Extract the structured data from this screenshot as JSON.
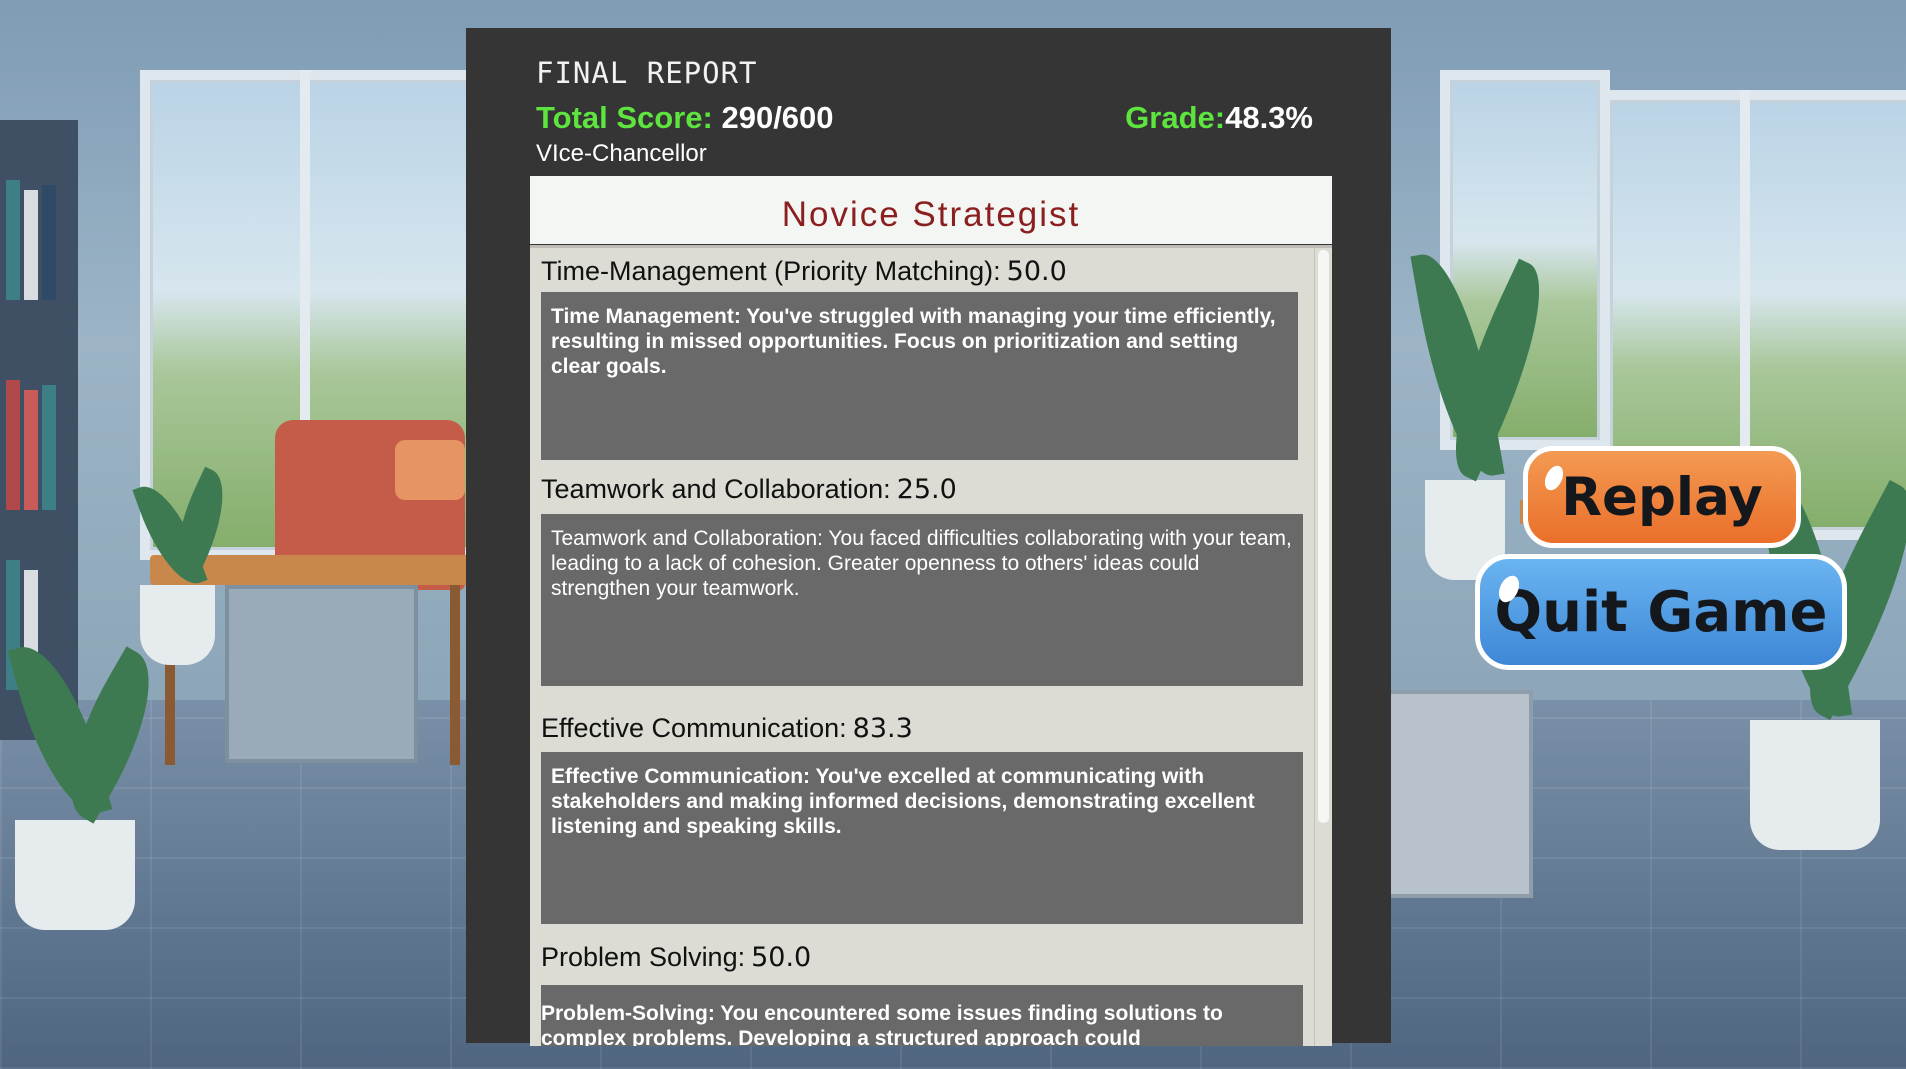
{
  "report": {
    "title": "FINAL REPORT",
    "total_score_label": "Total Score:",
    "total_score_value": "290/600",
    "grade_label": "Grade:",
    "grade_value": "48.3%",
    "role": "VIce-Chancellor",
    "rank_title": "Novice Strategist",
    "sections": [
      {
        "name": "Time-Management (Priority Matching):",
        "score": "50.0",
        "feedback": "Time Management: You've struggled with managing your time efficiently, resulting in missed opportunities. Focus on prioritization and setting clear goals."
      },
      {
        "name": "Teamwork and Collaboration:",
        "score": "25.0",
        "feedback": "Teamwork and Collaboration: You faced difficulties collaborating with your team, leading to a lack of cohesion. Greater openness to others' ideas could strengthen your teamwork."
      },
      {
        "name": "Effective Communication:",
        "score": "83.3",
        "feedback": "Effective Communication: You've excelled at communicating with stakeholders and making informed decisions, demonstrating excellent listening and speaking skills."
      },
      {
        "name": "Problem Solving:",
        "score": "50.0",
        "feedback": "Problem-Solving: You encountered some issues finding solutions to complex problems. Developing a structured approach could"
      }
    ]
  },
  "buttons": {
    "replay": "Replay",
    "quit": "Quit Game"
  },
  "colors": {
    "panel": "#353535",
    "accent_green": "#5ee43e",
    "rank_red": "#8b1e1e",
    "replay_orange": "#ea6f2a",
    "quit_blue": "#3d87d6"
  }
}
